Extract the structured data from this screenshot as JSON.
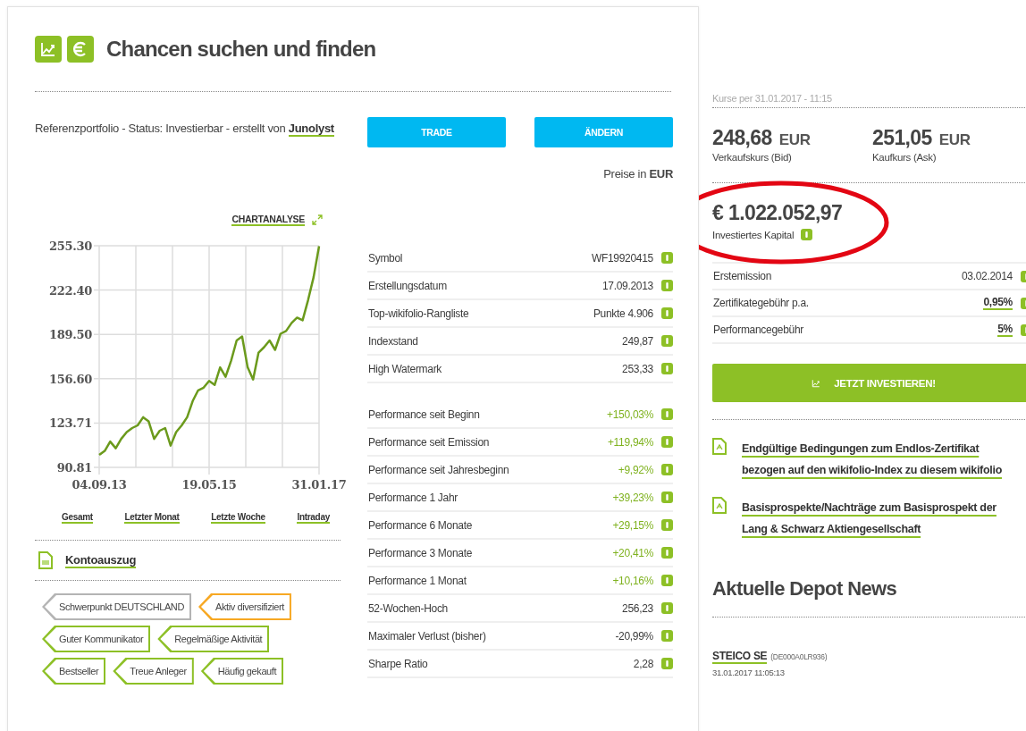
{
  "header": {
    "title": "Chancen suchen und finden"
  },
  "description": {
    "text": "Referenzportfolio - Status: Investierbar - erstellt von",
    "author": "Junolyst"
  },
  "actions": [
    {
      "label": "TRADE"
    },
    {
      "label": "ÄNDERN"
    }
  ],
  "currency_note": {
    "text": "Preise in",
    "currency": "EUR"
  },
  "chart_link": "CHARTANALYSE",
  "chart": {
    "chart_data": {
      "type": "line",
      "grid": true,
      "categories": [
        "04.09.13",
        null,
        null,
        null,
        null,
        null,
        null,
        null,
        null,
        null,
        null,
        null,
        null,
        null,
        null,
        null,
        null,
        null,
        null,
        null,
        "19.05.15",
        null,
        null,
        null,
        null,
        null,
        null,
        null,
        null,
        null,
        null,
        null,
        null,
        null,
        null,
        null,
        null,
        null,
        null,
        null,
        "31.01.17"
      ],
      "series": [
        {
          "color": "#6b9a1c",
          "values": [
            100,
            103,
            110,
            105,
            112,
            117,
            120,
            122,
            128,
            125,
            112,
            118,
            120,
            107,
            117,
            122,
            128,
            140,
            148,
            150,
            155,
            152,
            165,
            158,
            170,
            185,
            188,
            165,
            156,
            176,
            180,
            185,
            178,
            190,
            192,
            198,
            202,
            200,
            215,
            232,
            255
          ]
        }
      ],
      "ylim": [
        90.81,
        255.3
      ],
      "yticks": [
        {
          "value": 90.81,
          "label": "90.81"
        },
        {
          "value": 123.71,
          "label": "123.71"
        },
        {
          "value": 156.6,
          "label": "156.60"
        },
        {
          "value": 189.5,
          "label": "189.50"
        },
        {
          "value": 222.4,
          "label": "222.40"
        },
        {
          "value": 255.3,
          "label": "255.30"
        }
      ]
    }
  },
  "ranges": [
    {
      "label": "Gesamt"
    },
    {
      "label": "Letzter Monat"
    },
    {
      "label": "Letzte Woche"
    },
    {
      "label": "Intraday"
    }
  ],
  "statement_link": "Kontoauszug",
  "tags": [
    {
      "label": "Schwerpunkt DEUTSCHLAND",
      "color": "#b4b4b4"
    },
    {
      "label": "Aktiv diversifiziert",
      "color": "#f7a823"
    },
    {
      "label": "Guter Kommunikator",
      "color": "#8dc026"
    },
    {
      "label": "Regelmäßige Aktivität",
      "color": "#8dc026"
    },
    {
      "label": "Bestseller",
      "color": "#8dc026"
    },
    {
      "label": "Treue Anleger",
      "color": "#8dc026"
    },
    {
      "label": "Häufig gekauft",
      "color": "#8dc026"
    }
  ],
  "table": {
    "groups": [
      [
        {
          "label": "Symbol",
          "value": "WF19920415",
          "kind": "plain"
        },
        {
          "label": "Erstellungsdatum",
          "value": "17.09.2013",
          "kind": "plain"
        },
        {
          "label": "Top-wikifolio-Rangliste",
          "value": "Punkte 4.906",
          "kind": "plain"
        },
        {
          "label": "Indexstand",
          "value": "249,87",
          "kind": "plain"
        },
        {
          "label": "High Watermark",
          "value": "253,33",
          "kind": "plain"
        }
      ],
      [
        {
          "label": "Performance seit Beginn",
          "value": "+150,03%",
          "kind": "gain"
        },
        {
          "label": "Performance seit Emission",
          "value": "+119,94%",
          "kind": "gain"
        },
        {
          "label": "Performance seit Jahresbeginn",
          "value": "+9,92%",
          "kind": "gain"
        },
        {
          "label": "Performance 1 Jahr",
          "value": "+39,23%",
          "kind": "gain"
        },
        {
          "label": "Performance 6 Monate",
          "value": "+29,15%",
          "kind": "gain"
        },
        {
          "label": "Performance 3 Monate",
          "value": "+20,41%",
          "kind": "gain"
        },
        {
          "label": "Performance 1 Monat",
          "value": "+10,16%",
          "kind": "gain"
        },
        {
          "label": "52-Wochen-Hoch",
          "value": "256,23",
          "kind": "plain"
        },
        {
          "label": "Maximaler Verlust (bisher)",
          "value": "-20,99%",
          "kind": "plain"
        },
        {
          "label": "Sharpe Ratio",
          "value": "2,28",
          "kind": "plain"
        }
      ]
    ]
  },
  "quotes": {
    "timestamp": "Kurse per 31.01.2017 - 11:15",
    "prices": [
      {
        "amount": "248,68",
        "currency": "EUR",
        "label": "Verkaufskurs (Bid)"
      },
      {
        "amount": "251,05",
        "currency": "EUR",
        "label": "Kaufkurs (Ask)"
      }
    ]
  },
  "capital": {
    "amount": "€ 1.022.052,97",
    "label": "Investiertes Kapital",
    "highlight": {
      "kind": "ellipse"
    }
  },
  "facts": [
    {
      "label": "Erstemission",
      "value": "03.02.2014",
      "kind": "plain"
    },
    {
      "label": "Zertifikategebühr p.a.",
      "value": "0,95%",
      "kind": "link"
    },
    {
      "label": "Performancegebühr",
      "value": "5%",
      "kind": "link"
    }
  ],
  "invest_button": "JETZT INVESTIEREN!",
  "documents": [
    {
      "title": "Endgültige Bedingungen zum Endlos-Zertifikat bezogen auf den wikifolio-Index zu diesem wikifolio"
    },
    {
      "title": "Basisprospekte/Nachträge zum Basisprospekt der Lang & Schwarz Aktiengesellschaft"
    }
  ],
  "news": {
    "title": "Aktuelle Depot News",
    "items": [
      {
        "company": "STEICO SE",
        "isin": "(DE000A0LR936)",
        "date": "31.01.2017 11:05:13"
      }
    ]
  }
}
